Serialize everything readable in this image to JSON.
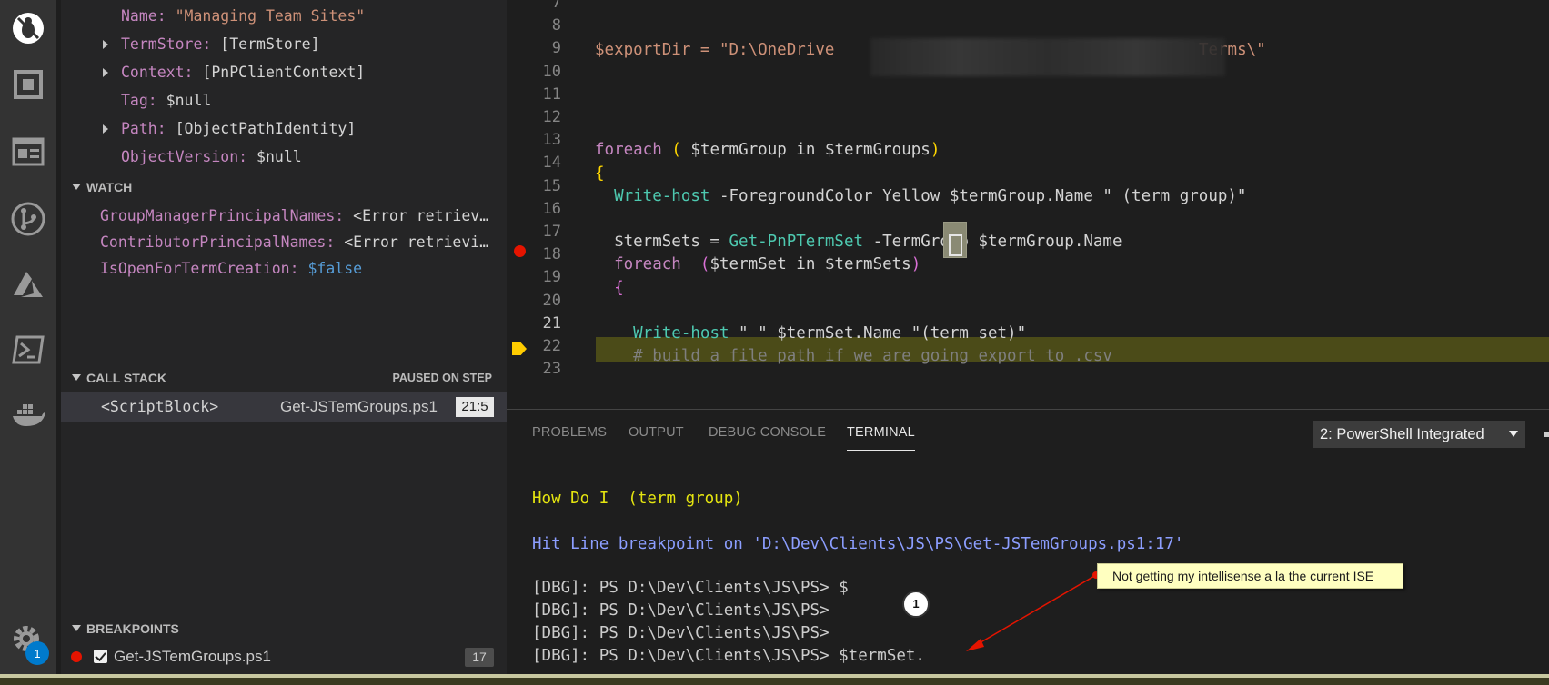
{
  "activity_bar": {
    "icons": [
      "debug-off-icon",
      "extensions-icon",
      "explorer-panel-icon",
      "source-control-icon",
      "azure-icon",
      "powershell-icon",
      "docker-icon",
      "gear-icon"
    ],
    "settings_badge": "1"
  },
  "variables": [
    {
      "name": "Name:",
      "value": "\"Managing Team Sites\"",
      "kind": "string",
      "expandable": false
    },
    {
      "name": "TermStore:",
      "value": "[TermStore]",
      "kind": "plain",
      "expandable": true
    },
    {
      "name": "Context:",
      "value": "[PnPClientContext]",
      "kind": "plain",
      "expandable": true
    },
    {
      "name": "Tag:",
      "value": "$null",
      "kind": "plain",
      "expandable": false
    },
    {
      "name": "Path:",
      "value": "[ObjectPathIdentity]",
      "kind": "plain",
      "expandable": true
    },
    {
      "name": "ObjectVersion:",
      "value": "$null",
      "kind": "plain",
      "expandable": false
    }
  ],
  "watch": {
    "title": "WATCH",
    "items": [
      {
        "name": "GroupManagerPrincipalNames:",
        "value": "<Error retriev…"
      },
      {
        "name": "ContributorPrincipalNames:",
        "value": "<Error retrievi…"
      },
      {
        "name": "IsOpenForTermCreation:",
        "value": "$false"
      }
    ]
  },
  "call_stack": {
    "title": "CALL STACK",
    "status": "PAUSED ON STEP",
    "frame_name": "<ScriptBlock>",
    "frame_file": "Get-JSTemGroups.ps1",
    "frame_position": "21:5"
  },
  "breakpoints": {
    "title": "BREAKPOINTS",
    "file": "Get-JSTemGroups.ps1",
    "line": "17"
  },
  "editor": {
    "line_numbers": [
      "7",
      "8",
      "9",
      "10",
      "11",
      "12",
      "13",
      "14",
      "15",
      "16",
      "17",
      "18",
      "19",
      "20",
      "21",
      "22",
      "23"
    ],
    "export_dir_prefix": "$exportDir = \"D:\\OneDrive ",
    "export_dir_suffix": "Terms\\\"",
    "foreach_outer": "$termGroup in $termGroups",
    "write_host_1_args": "-ForegroundColor Yellow $termGroup.Name \" (term group)\"",
    "term_sets_assign": "$termSets = ",
    "get_cmd": "Get-PnPTermSet",
    "get_args": " -TermGroup $termGroup.Name",
    "foreach_inner": "$termSet in $termSets",
    "write_host_2_args": " \" \" $termSet.Name \"(term set)\"",
    "comment": "# build a file path if we are going export to .csv"
  },
  "panel": {
    "tabs": [
      "PROBLEMS",
      "OUTPUT",
      "DEBUG CONSOLE",
      "TERMINAL"
    ],
    "active_tab": "TERMINAL",
    "terminal_select": "2: PowerShell Integrated",
    "lines": [
      "How Do I  (term group)",
      "Hit Line breakpoint on 'D:\\Dev\\Clients\\JS\\PS\\Get-JSTemGroups.ps1:17'",
      "[DBG]: PS D:\\Dev\\Clients\\JS\\PS> $",
      "[DBG]: PS D:\\Dev\\Clients\\JS\\PS>",
      "[DBG]: PS D:\\Dev\\Clients\\JS\\PS>",
      "[DBG]: PS D:\\Dev\\Clients\\JS\\PS> $termSet."
    ]
  },
  "annotation": {
    "callout_text": "Not getting my intellisense a la the current ISE",
    "step_number": "1",
    "arrow_color": "#e51400"
  },
  "colors": {
    "breakpoint": "#e51400",
    "current_line_bg": "#4b4b18",
    "terminal_yellow": "#e5e510",
    "terminal_blue": "#8c9eff",
    "accent": "#007acc"
  }
}
